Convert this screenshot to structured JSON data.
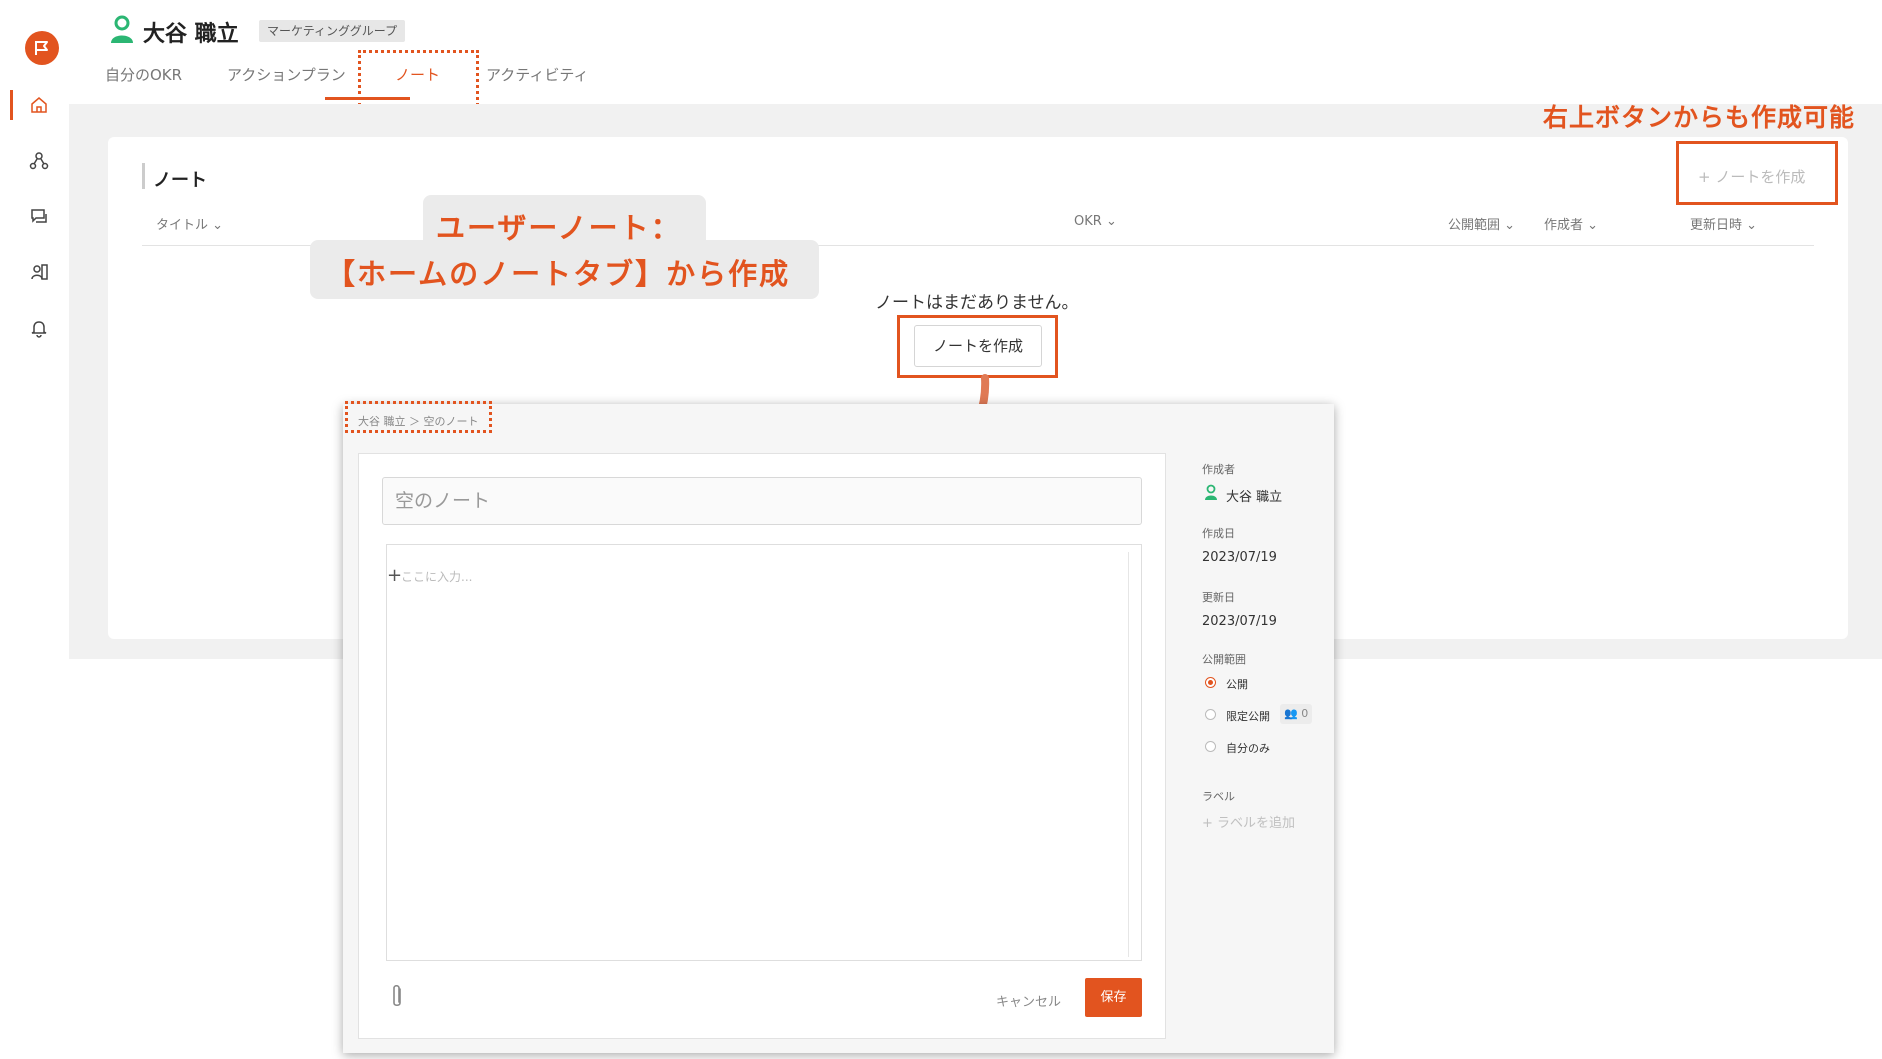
{
  "user": {
    "name": "大谷 職立",
    "group": "マーケティンググループ"
  },
  "tabs": [
    {
      "label": "自分のOKR"
    },
    {
      "label": "アクションプラン"
    },
    {
      "label": "ノート"
    },
    {
      "label": "アクティビティ"
    }
  ],
  "notes": {
    "title": "ノート",
    "columns": [
      "タイトル",
      "OKR",
      "公開範囲",
      "作成者",
      "更新日時"
    ],
    "create_label": "ノートを作成",
    "empty_message": "ノートはまだありません。",
    "create_button": "ノートを作成"
  },
  "annotations": {
    "top_right_hint": "右上ボタンからも作成可能",
    "callout_line1": "ユーザーノート：",
    "callout_line2": "【ホームのノートタブ】から作成"
  },
  "editor": {
    "breadcrumb": "大谷 職立 ＞ 空のノート",
    "title_placeholder": "空のノート",
    "body_placeholder": "ここに入力...",
    "cancel_label": "キャンセル",
    "save_label": "保存"
  },
  "sidebar_meta": {
    "author_label": "作成者",
    "author_name": "大谷 職立",
    "created_label": "作成日",
    "created_value": "2023/07/19",
    "updated_label": "更新日",
    "updated_value": "2023/07/19",
    "visibility_label": "公開範囲",
    "visibility_options": [
      "公開",
      "限定公開",
      "自分のみ"
    ],
    "member_count": "0",
    "label_label": "ラベル",
    "add_label": "ラベルを追加"
  },
  "colors": {
    "accent": "#e2541f",
    "user_icon": "#2bb673"
  },
  "icons": {
    "logo": "flag-logo-icon",
    "nav": [
      "home-icon",
      "network-icon",
      "chat-icon",
      "contacts-icon",
      "bell-icon"
    ]
  }
}
